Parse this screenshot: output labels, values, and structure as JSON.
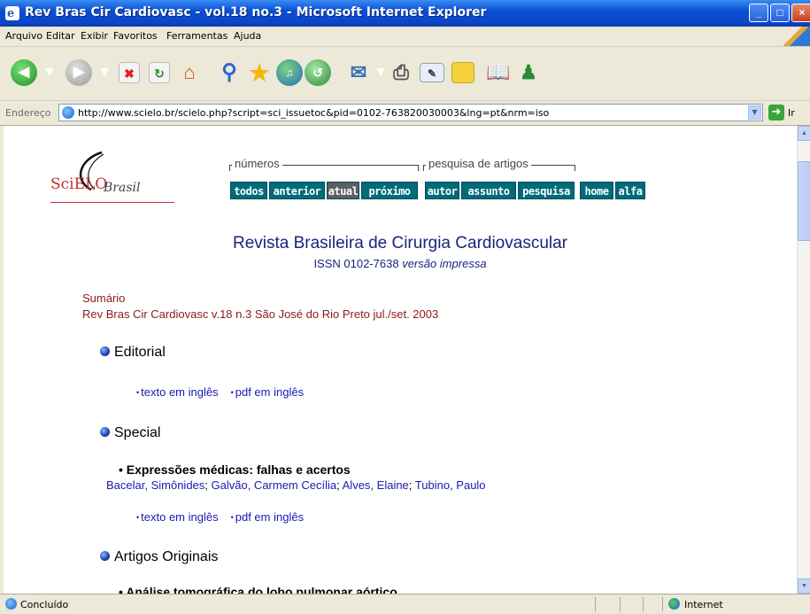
{
  "window": {
    "title": "Rev Bras Cir Cardiovasc - vol.18 no.3 - Microsoft Internet Explorer",
    "app_icon_glyph": "e",
    "buttons": {
      "minimize": "_",
      "maximize": "□",
      "close": "×"
    }
  },
  "menu": [
    "Arquivo",
    "Editar",
    "Exibir",
    "Favoritos",
    "Ferramentas",
    "Ajuda"
  ],
  "toolbar": {
    "icons": [
      "back-icon",
      "forward-icon",
      "stop-icon",
      "refresh-icon",
      "home-icon",
      "search-icon",
      "favorites-icon",
      "media-icon",
      "history-icon",
      "mail-icon",
      "print-icon",
      "edit-icon",
      "discuss-icon",
      "research-icon",
      "messenger-icon"
    ]
  },
  "address": {
    "label": "Endereço",
    "url": "http://www.scielo.br/scielo.php?script=sci_issuetoc&pid=0102-763820030003&lng=pt&nrm=iso",
    "go_label": "Ir"
  },
  "logo": {
    "sci": "SciELO",
    "brasil": "Brasil"
  },
  "nav": {
    "group_numeros": "números",
    "group_pesquisa": "pesquisa de artigos",
    "buttons": [
      "todos",
      "anterior",
      "atual",
      "próximo",
      "autor",
      "assunto",
      "pesquisa",
      "home",
      "alfa"
    ]
  },
  "journal": {
    "title": "Revista Brasileira de Cirurgia Cardiovascular",
    "issn": "ISSN 0102-7638",
    "version": "versão impressa"
  },
  "toc": {
    "sumario": "Sumário",
    "issue": "Rev Bras Cir Cardiovasc v.18 n.3 São José do Rio Preto jul./set. 2003"
  },
  "sections": {
    "editorial": {
      "heading": "Editorial",
      "links": [
        "texto em inglês",
        "pdf em inglês"
      ]
    },
    "special": {
      "heading": "Special",
      "article_title": "Expressões médicas: falhas e acertos",
      "authors": [
        "Bacelar, Simônides",
        "Galvão, Carmem Cecília",
        "Alves, Elaine",
        "Tubino, Paulo"
      ],
      "links": [
        "texto em inglês",
        "pdf em inglês"
      ]
    },
    "originais": {
      "heading": "Artigos Originais",
      "partial_title": "• Análise tomográfica do lobo pulmonar aórtico"
    }
  },
  "link_bullet": "•",
  "status": {
    "text": "Concluído",
    "zone": "Internet"
  }
}
